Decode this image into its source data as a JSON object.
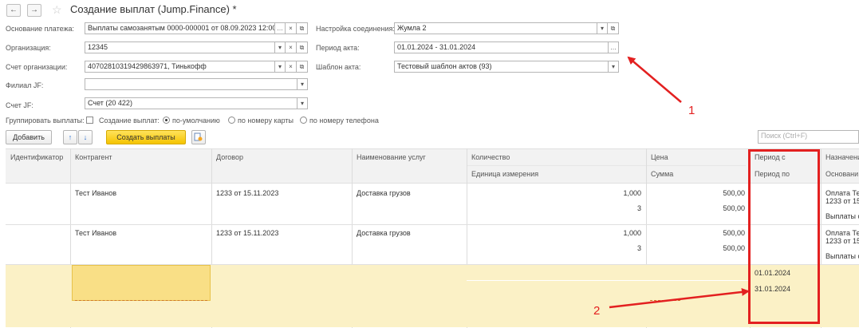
{
  "window": {
    "title": "Создание выплат (Jump.Finance) *",
    "back": "←",
    "forward": "→",
    "star": "☆"
  },
  "form": {
    "osnovanie": {
      "label": "Основание платежа:",
      "value": "Выплаты самозанятым 0000-000001 от 08.09.2023 12:00:..."
    },
    "organizaciya": {
      "label": "Организация:",
      "value": "12345"
    },
    "schet_org": {
      "label": "Счет организации:",
      "value": "40702810319429863971, Тинькофф"
    },
    "filial": {
      "label": "Филиал JF:",
      "value": ""
    },
    "schet_jf": {
      "label": "Счет JF:",
      "value": "Счет (20 422)"
    },
    "nastroika": {
      "label": "Настройка соединения:",
      "value": "Жумла 2"
    },
    "period_akta": {
      "label": "Период акта:",
      "value": "01.01.2024 - 31.01.2024"
    },
    "shablon": {
      "label": "Шаблон акта:",
      "value": "Тестовый шаблон актов (93)"
    },
    "group_label": "Группировать выплаты:",
    "creation_label": "Создание выплат:",
    "radio_options": [
      "по-умолчанию",
      "по номеру карты",
      "по номеру телефона"
    ]
  },
  "toolbar": {
    "add_label": "Добавить",
    "up": "↑",
    "down": "↓",
    "create_label": "Создать выплаты",
    "search_placeholder": "Поиск (Ctrl+F)"
  },
  "columns": {
    "id": "Идентификатор",
    "kontragent": "Контрагент",
    "dogovor": "Договор",
    "naimenovanie": "Наименование услуг",
    "kolichestvo": "Количество",
    "edinica": "Единица измерения",
    "cena": "Цена",
    "summa": "Сумма",
    "period_s": "Период с",
    "period_po": "Период по",
    "naznachenie": "Назначени",
    "osnovanie": "Основани"
  },
  "rows": [
    {
      "kontragent": "Тест Иванов",
      "dogovor": "1233 от 15.11.2023",
      "naimenovanie": "Доставка грузов",
      "kolichestvo": "1,000",
      "edinica": "3",
      "cena": "500,00",
      "summa": "500,00",
      "naznachenie_1": "Оплата Те",
      "naznachenie_2": "1233 от 15",
      "osnovanie": "Выплаты с"
    },
    {
      "kontragent": "Тест Иванов",
      "dogovor": "1233 от 15.11.2023",
      "naimenovanie": "Доставка грузов",
      "kolichestvo": "1,000",
      "edinica": "3",
      "cena": "500,00",
      "summa": "500,00",
      "naznachenie_1": "Оплата Те",
      "naznachenie_2": "1233 от 15",
      "osnovanie": "Выплаты с"
    },
    {
      "period_s": "01.01.2024",
      "period_po": "31.01.2024"
    }
  ],
  "annotations": {
    "label_1": "1",
    "label_2": "2",
    "highlight_color": "#e32020"
  }
}
